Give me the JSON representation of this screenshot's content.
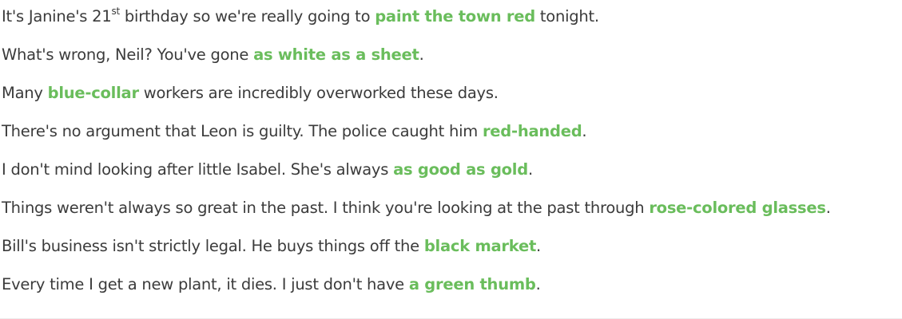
{
  "sentences": [
    {
      "pre": "It's Janine's 21",
      "sup": "st",
      "mid": " birthday so we're really going to ",
      "idiom": "paint the town red",
      "post": " tonight."
    },
    {
      "pre": "What's wrong, Neil? You've gone ",
      "idiom": "as white as a sheet",
      "post": "."
    },
    {
      "pre": "Many ",
      "idiom": "blue-collar",
      "post": " workers are incredibly overworked these days."
    },
    {
      "pre": "There's no argument that Leon is guilty. The police caught him ",
      "idiom": "red-handed",
      "post": "."
    },
    {
      "pre": "I don't mind looking after little Isabel. She's always ",
      "idiom": "as good as gold",
      "post": "."
    },
    {
      "pre": "Things weren't always so great in the past. I think you're looking at the past through ",
      "idiom": "rose-colored glasses",
      "post": "."
    },
    {
      "pre": "Bill's business isn't strictly legal. He buys things off the ",
      "idiom": "black market",
      "post": "."
    },
    {
      "pre": "Every time I get a new plant, it dies. I just don't have ",
      "idiom": "a green thumb",
      "post": "."
    }
  ],
  "colors": {
    "text": "#3b3b3b",
    "highlight": "#6abd5c"
  }
}
